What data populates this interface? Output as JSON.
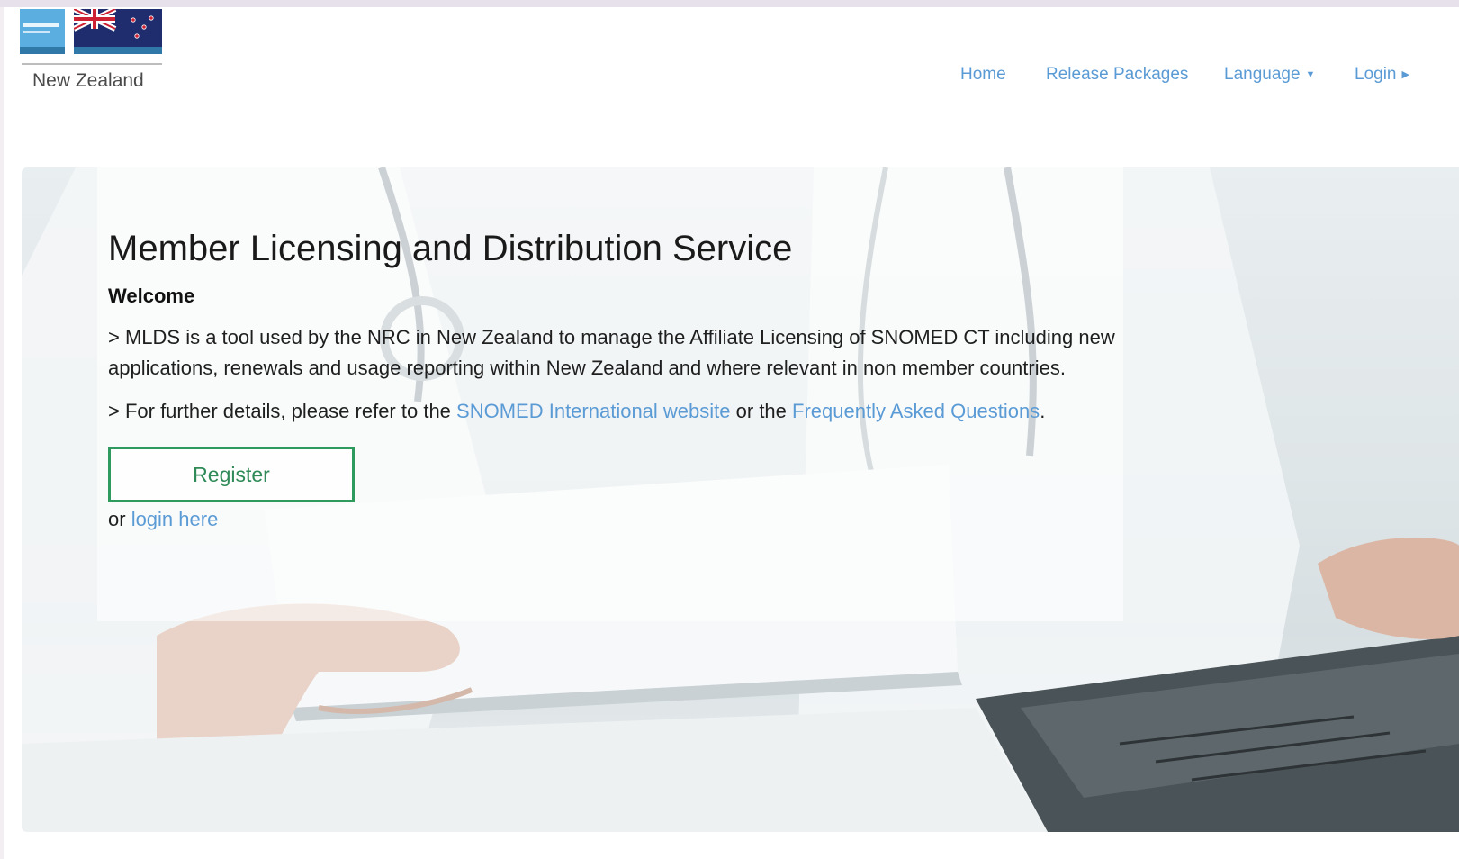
{
  "header": {
    "logo_caption": "New Zealand",
    "nav": [
      {
        "label": "Home"
      },
      {
        "label": "Release Packages"
      },
      {
        "label": "Language"
      },
      {
        "label": "Login"
      }
    ]
  },
  "hero": {
    "title": "Member Licensing and Distribution Service",
    "welcome": "Welcome",
    "paragraph_1": "> MLDS is a tool used by the NRC in New Zealand to manage the Affiliate Licensing of SNOMED CT including new applications, renewals and usage reporting within New Zealand and where relevant in non member countries.",
    "paragraph_2_prefix": "> For further details, please refer to the",
    "link_snomed_site": "SNOMED International website",
    "paragraph_2_middle": "or the",
    "link_faq": "Frequently Asked Questions",
    "paragraph_2_suffix": ".",
    "register_label": "Register",
    "or_text": "or",
    "login_here_label": "login here"
  },
  "colors": {
    "link": "#5b9bd5",
    "register_border": "#2f9a5e"
  }
}
